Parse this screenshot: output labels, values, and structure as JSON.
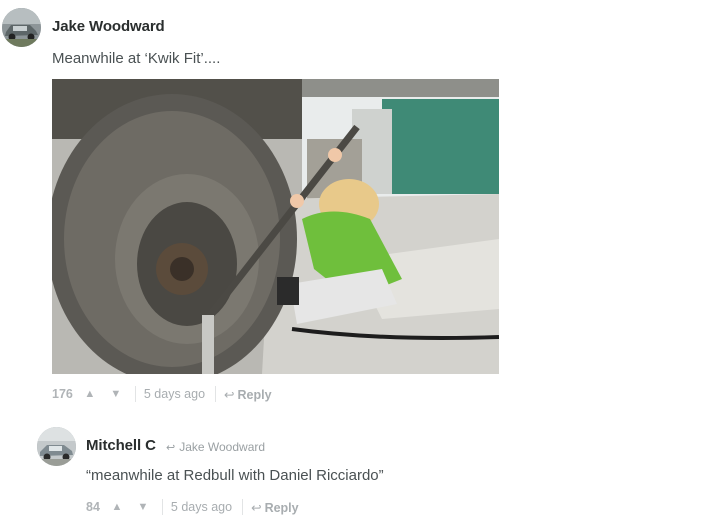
{
  "comments": [
    {
      "author": "Jake Woodward",
      "text": "Meanwhile at ‘Kwik Fit’....",
      "votes": "176",
      "upvote_icon": "▲",
      "downvote_icon": "▼",
      "time": "5 days ago",
      "reply_icon": "↩",
      "reply_label": "Reply"
    },
    {
      "author": "Mitchell C",
      "in_reply_to": "Jake Woodward",
      "text": "“meanwhile at Redbull with Daniel Ricciardo”",
      "votes": "84",
      "upvote_icon": "▲",
      "downvote_icon": "▼",
      "time": "5 days ago",
      "reply_icon": "↩",
      "reply_label": "Reply"
    }
  ],
  "icons": {
    "reply_to_arrow": "↩"
  },
  "colors": {
    "author": "#2a2e2e",
    "body_text": "#4a5153",
    "meta": "#a8adb0"
  }
}
